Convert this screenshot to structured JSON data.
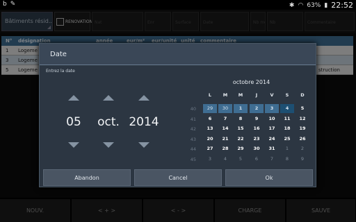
{
  "status": {
    "left_icons": [
      "b",
      "pen-icon"
    ],
    "battery": "63%",
    "time": "22:52"
  },
  "toolbar": {
    "building_select": "Bâtiments résid...",
    "renovation_label": "RENOVATION",
    "fields": [
      "Nat",
      "Enr",
      "Surface",
      "Date",
      "Nb mois",
      "Nb",
      "Commentaire"
    ]
  },
  "table": {
    "headers": [
      "N°",
      "désignation",
      "année",
      "eur/m²",
      "eur/unité",
      "unité",
      "commentaire"
    ],
    "rows": [
      {
        "n": "1",
        "designation": "Logeme",
        "extra": ""
      },
      {
        "n": "3",
        "designation": "Logeme",
        "extra": ""
      },
      {
        "n": "5",
        "designation": "Logeme",
        "extra": "struction"
      }
    ]
  },
  "bottom_buttons": [
    "NOUV.",
    "< + >",
    "< - >",
    "CHARGE",
    "SAUVE"
  ],
  "dialog": {
    "title": "Date",
    "subtitle": "Entrez la date",
    "day": "05",
    "month": "oct.",
    "year": "2014",
    "calendar": {
      "month_title": "octobre 2014",
      "weekday_headers": [
        "L",
        "M",
        "M",
        "J",
        "V",
        "S",
        "D"
      ],
      "weeks": [
        {
          "wk": "40",
          "days": [
            "29",
            "30",
            "1",
            "2",
            "3",
            "4",
            "5"
          ]
        },
        {
          "wk": "41",
          "days": [
            "6",
            "7",
            "8",
            "9",
            "10",
            "11",
            "12"
          ]
        },
        {
          "wk": "42",
          "days": [
            "13",
            "14",
            "15",
            "16",
            "17",
            "18",
            "19"
          ]
        },
        {
          "wk": "43",
          "days": [
            "20",
            "21",
            "22",
            "23",
            "24",
            "25",
            "26"
          ]
        },
        {
          "wk": "44",
          "days": [
            "27",
            "28",
            "29",
            "30",
            "31",
            "1",
            "2"
          ]
        },
        {
          "wk": "45",
          "days": [
            "3",
            "4",
            "5",
            "6",
            "7",
            "8",
            "9"
          ]
        }
      ]
    },
    "buttons": {
      "abandon": "Abandon",
      "cancel": "Cancel",
      "ok": "Ok"
    }
  },
  "colors": {
    "accent": "#3f6d92",
    "dialog_bg": "#2c3642"
  }
}
